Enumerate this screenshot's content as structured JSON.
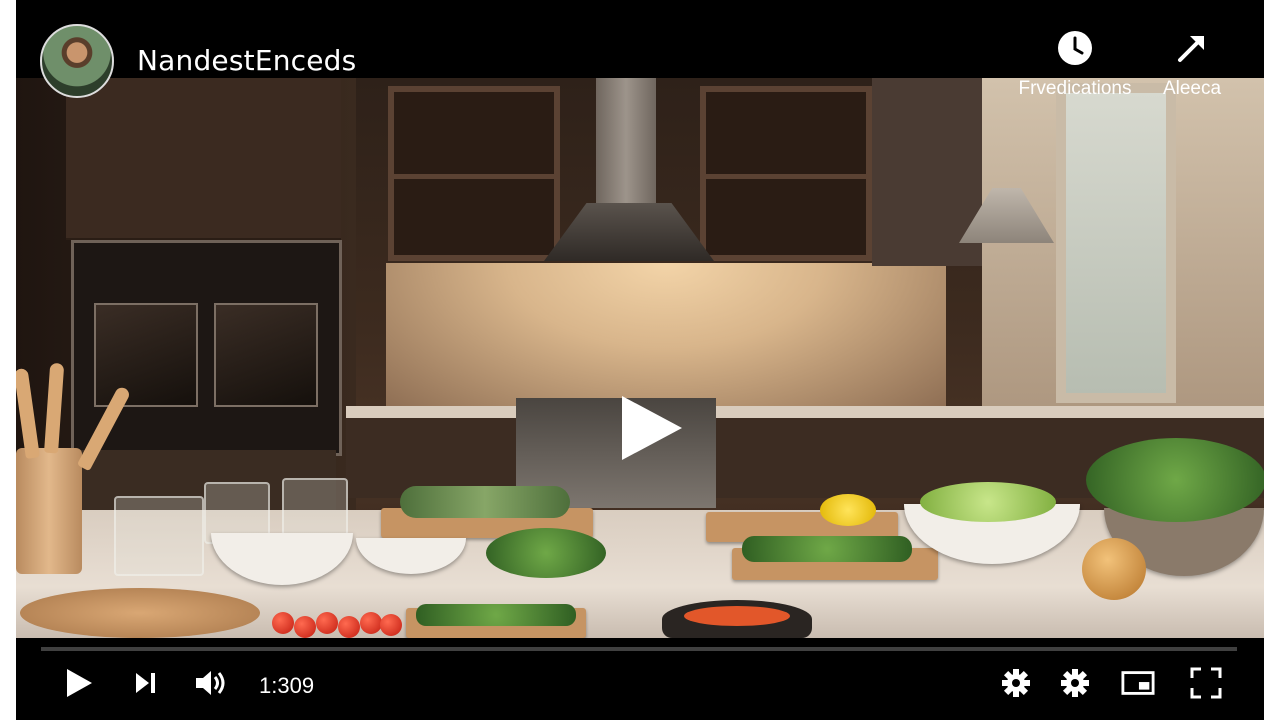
{
  "channel": {
    "name": "NandestEnceds"
  },
  "top_actions": [
    {
      "label": "Frvedications",
      "icon": "clock-icon"
    },
    {
      "label": "Aleeca",
      "icon": "share-arrow-icon"
    }
  ],
  "player": {
    "time": "1:309",
    "progress": 0.0,
    "controls": [
      "play-icon",
      "next-icon",
      "volume-icon",
      "settings-icon",
      "settings-icon",
      "miniplayer-icon",
      "fullscreen-icon"
    ]
  },
  "colors": {
    "background": "#000000",
    "text": "#ffffff"
  }
}
